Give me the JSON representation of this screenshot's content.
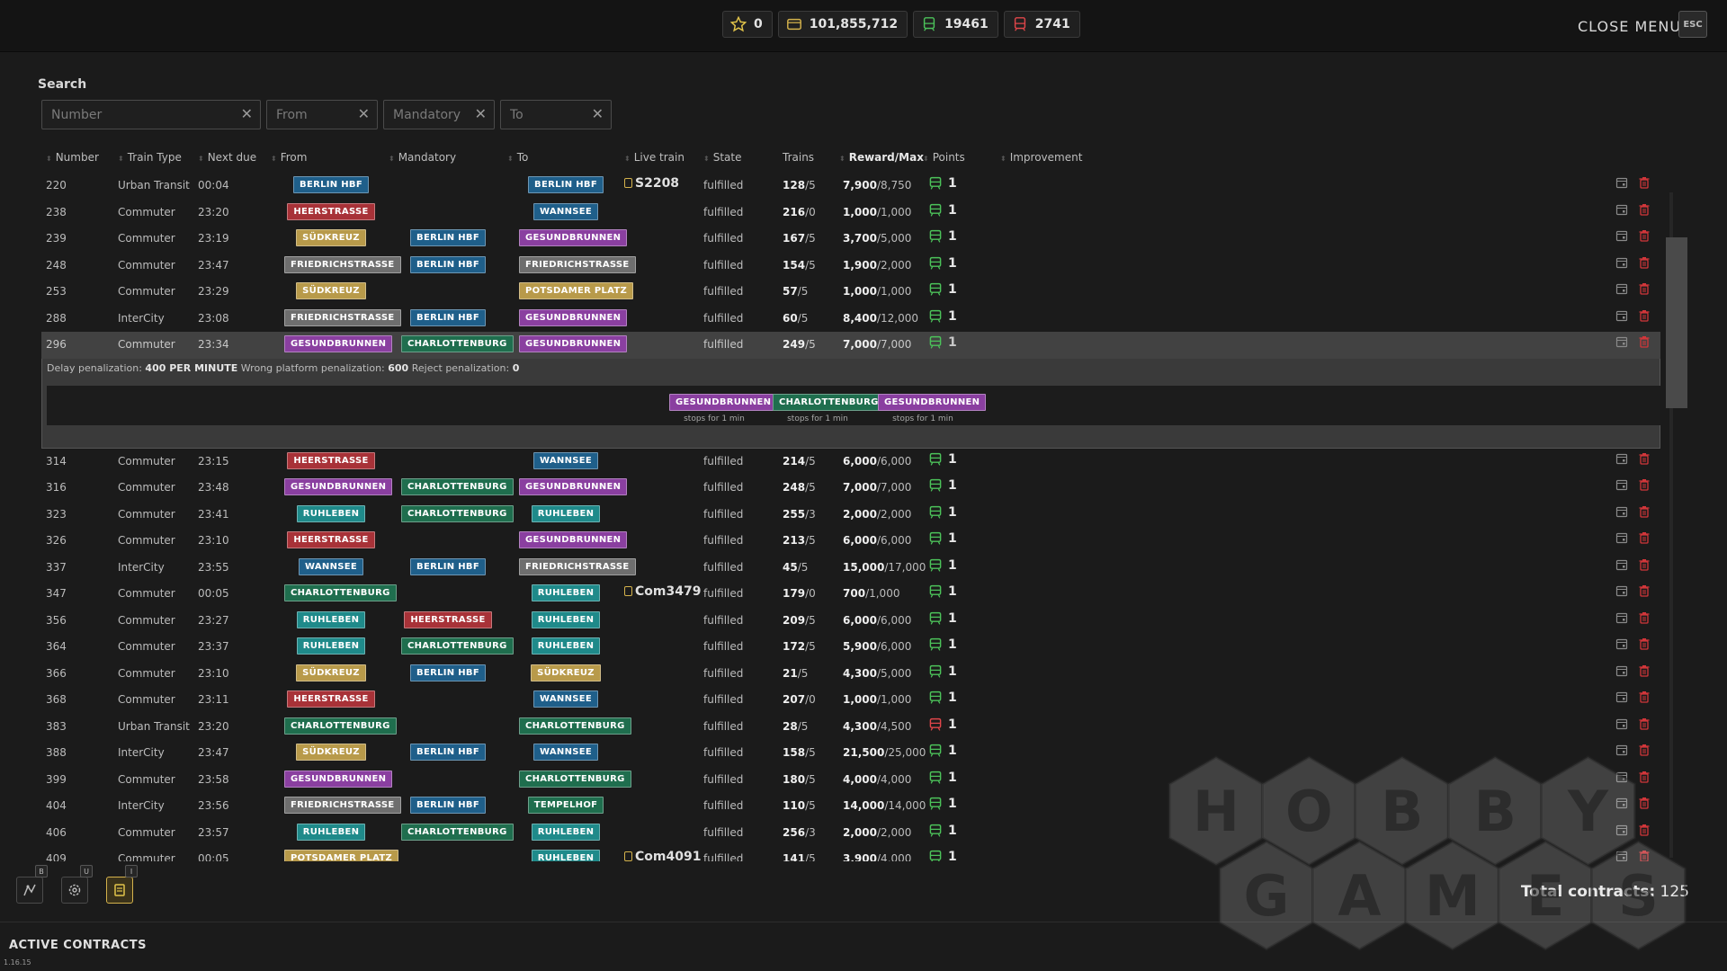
{
  "topbar": {
    "stats": [
      {
        "name": "star-icon",
        "value": "0",
        "color": "#e2c44a"
      },
      {
        "name": "money-icon",
        "value": "101,855,712",
        "color": "#d4b24c"
      },
      {
        "name": "train-green-icon",
        "value": "19461",
        "color": "#4cc25a"
      },
      {
        "name": "train-red-icon",
        "value": "2741",
        "color": "#e0464a"
      }
    ],
    "close_label": "CLOSE MENU",
    "esc_label": "ESC"
  },
  "search": {
    "title": "Search",
    "filters": [
      {
        "placeholder": "Number",
        "value": ""
      },
      {
        "placeholder": "From",
        "value": ""
      },
      {
        "placeholder": "Mandatory",
        "value": ""
      },
      {
        "placeholder": "To",
        "value": ""
      }
    ]
  },
  "columns": [
    "Number",
    "Train Type",
    "Next due",
    "From",
    "Mandatory",
    "To",
    "Live train",
    "State",
    "Trains",
    "Reward/Max",
    "Points",
    "Improvement"
  ],
  "station_colors": {
    "Berlin HBF": "#1f5f8a",
    "Heerstraße": "#a83238",
    "Südkreuz": "#b89a4a",
    "Friedrichstraße": "#6e6e6e",
    "Gesundbrunnen": "#8a3fa0",
    "Charlottenburg": "#1f6e4e",
    "Wannsee": "#1f5f8a",
    "Potsdamer Platz": "#b89a4a",
    "Ruhleben": "#1f8a8a",
    "Tempelhof": "#1f6e4e"
  },
  "rows": [
    {
      "num": "220",
      "type": "Urban Transit",
      "due": "00:04",
      "from": "Berlin HBF",
      "mand": "",
      "to": "Berlin HBF",
      "live": "S2208",
      "state": "fulfilled",
      "trains": "128",
      "trains_max": "/5",
      "reward": "7,900",
      "reward_max": "/8,750",
      "points": "1",
      "points_ok": true
    },
    {
      "num": "238",
      "type": "Commuter",
      "due": "23:20",
      "from": "Heerstraße",
      "mand": "",
      "to": "Wannsee",
      "live": "",
      "state": "fulfilled",
      "trains": "216",
      "trains_max": "/0",
      "reward": "1,000",
      "reward_max": "/1,000",
      "points": "1",
      "points_ok": true
    },
    {
      "num": "239",
      "type": "Commuter",
      "due": "23:19",
      "from": "Südkreuz",
      "mand": "Berlin HBF",
      "to": "Gesundbrunnen",
      "live": "",
      "state": "fulfilled",
      "trains": "167",
      "trains_max": "/5",
      "reward": "3,700",
      "reward_max": "/5,000",
      "points": "1",
      "points_ok": true
    },
    {
      "num": "248",
      "type": "Commuter",
      "due": "23:47",
      "from": "Friedrichstraße",
      "mand": "Berlin HBF",
      "to": "Friedrichstraße",
      "live": "",
      "state": "fulfilled",
      "trains": "154",
      "trains_max": "/5",
      "reward": "1,900",
      "reward_max": "/2,000",
      "points": "1",
      "points_ok": true
    },
    {
      "num": "253",
      "type": "Commuter",
      "due": "23:29",
      "from": "Südkreuz",
      "mand": "",
      "to": "Potsdamer Platz",
      "live": "",
      "state": "fulfilled",
      "trains": "57",
      "trains_max": "/5",
      "reward": "1,000",
      "reward_max": "/1,000",
      "points": "1",
      "points_ok": true
    },
    {
      "num": "288",
      "type": "InterCity",
      "due": "23:08",
      "from": "Friedrichstraße",
      "mand": "Berlin HBF",
      "to": "Gesundbrunnen",
      "live": "",
      "state": "fulfilled",
      "trains": "60",
      "trains_max": "/5",
      "reward": "8,400",
      "reward_max": "/12,000",
      "points": "1",
      "points_ok": true
    },
    {
      "num": "296",
      "type": "Commuter",
      "due": "23:34",
      "from": "Gesundbrunnen",
      "mand": "Charlottenburg",
      "to": "Gesundbrunnen",
      "live": "",
      "state": "fulfilled",
      "trains": "249",
      "trains_max": "/5",
      "reward": "7,000",
      "reward_max": "/7,000",
      "points": "1",
      "points_ok": true,
      "selected": true
    },
    {
      "num": "314",
      "type": "Commuter",
      "due": "23:15",
      "from": "Heerstraße",
      "mand": "",
      "to": "Wannsee",
      "live": "",
      "state": "fulfilled",
      "trains": "214",
      "trains_max": "/5",
      "reward": "6,000",
      "reward_max": "/6,000",
      "points": "1",
      "points_ok": true
    },
    {
      "num": "316",
      "type": "Commuter",
      "due": "23:48",
      "from": "Gesundbrunnen",
      "mand": "Charlottenburg",
      "to": "Gesundbrunnen",
      "live": "",
      "state": "fulfilled",
      "trains": "248",
      "trains_max": "/5",
      "reward": "7,000",
      "reward_max": "/7,000",
      "points": "1",
      "points_ok": true
    },
    {
      "num": "323",
      "type": "Commuter",
      "due": "23:41",
      "from": "Ruhleben",
      "mand": "Charlottenburg",
      "to": "Ruhleben",
      "live": "",
      "state": "fulfilled",
      "trains": "255",
      "trains_max": "/3",
      "reward": "2,000",
      "reward_max": "/2,000",
      "points": "1",
      "points_ok": true
    },
    {
      "num": "326",
      "type": "Commuter",
      "due": "23:10",
      "from": "Heerstraße",
      "mand": "",
      "to": "Gesundbrunnen",
      "live": "",
      "state": "fulfilled",
      "trains": "213",
      "trains_max": "/5",
      "reward": "6,000",
      "reward_max": "/6,000",
      "points": "1",
      "points_ok": true
    },
    {
      "num": "337",
      "type": "InterCity",
      "due": "23:55",
      "from": "Wannsee",
      "mand": "Berlin HBF",
      "to": "Friedrichstraße",
      "live": "",
      "state": "fulfilled",
      "trains": "45",
      "trains_max": "/5",
      "reward": "15,000",
      "reward_max": "/17,000",
      "points": "1",
      "points_ok": true
    },
    {
      "num": "347",
      "type": "Commuter",
      "due": "00:05",
      "from": "Charlottenburg",
      "mand": "",
      "to": "Ruhleben",
      "live": "Com3479",
      "state": "fulfilled",
      "trains": "179",
      "trains_max": "/0",
      "reward": "700",
      "reward_max": "/1,000",
      "points": "1",
      "points_ok": true
    },
    {
      "num": "356",
      "type": "Commuter",
      "due": "23:27",
      "from": "Ruhleben",
      "mand": "Heerstraße",
      "to": "Ruhleben",
      "live": "",
      "state": "fulfilled",
      "trains": "209",
      "trains_max": "/5",
      "reward": "6,000",
      "reward_max": "/6,000",
      "points": "1",
      "points_ok": true
    },
    {
      "num": "364",
      "type": "Commuter",
      "due": "23:37",
      "from": "Ruhleben",
      "mand": "Charlottenburg",
      "to": "Ruhleben",
      "live": "",
      "state": "fulfilled",
      "trains": "172",
      "trains_max": "/5",
      "reward": "5,900",
      "reward_max": "/6,000",
      "points": "1",
      "points_ok": true
    },
    {
      "num": "366",
      "type": "Commuter",
      "due": "23:10",
      "from": "Südkreuz",
      "mand": "Berlin HBF",
      "to": "Südkreuz",
      "live": "",
      "state": "fulfilled",
      "trains": "21",
      "trains_max": "/5",
      "reward": "4,300",
      "reward_max": "/5,000",
      "points": "1",
      "points_ok": true
    },
    {
      "num": "368",
      "type": "Commuter",
      "due": "23:11",
      "from": "Heerstraße",
      "mand": "",
      "to": "Wannsee",
      "live": "",
      "state": "fulfilled",
      "trains": "207",
      "trains_max": "/0",
      "reward": "1,000",
      "reward_max": "/1,000",
      "points": "1",
      "points_ok": true
    },
    {
      "num": "383",
      "type": "Urban Transit",
      "due": "23:20",
      "from": "Charlottenburg",
      "mand": "",
      "to": "Charlottenburg",
      "live": "",
      "state": "fulfilled",
      "trains": "28",
      "trains_max": "/5",
      "reward": "4,300",
      "reward_max": "/4,500",
      "points": "1",
      "points_ok": false
    },
    {
      "num": "388",
      "type": "InterCity",
      "due": "23:47",
      "from": "Südkreuz",
      "mand": "Berlin HBF",
      "to": "Wannsee",
      "live": "",
      "state": "fulfilled",
      "trains": "158",
      "trains_max": "/5",
      "reward": "21,500",
      "reward_max": "/25,000",
      "points": "1",
      "points_ok": true
    },
    {
      "num": "399",
      "type": "Commuter",
      "due": "23:58",
      "from": "Gesundbrunnen",
      "mand": "",
      "to": "Charlottenburg",
      "live": "",
      "state": "fulfilled",
      "trains": "180",
      "trains_max": "/5",
      "reward": "4,000",
      "reward_max": "/4,000",
      "points": "1",
      "points_ok": true
    },
    {
      "num": "404",
      "type": "InterCity",
      "due": "23:56",
      "from": "Friedrichstraße",
      "mand": "Berlin HBF",
      "to": "Tempelhof",
      "live": "",
      "state": "fulfilled",
      "trains": "110",
      "trains_max": "/5",
      "reward": "14,000",
      "reward_max": "/14,000",
      "points": "1",
      "points_ok": true
    },
    {
      "num": "406",
      "type": "Commuter",
      "due": "23:57",
      "from": "Ruhleben",
      "mand": "Charlottenburg",
      "to": "Ruhleben",
      "live": "",
      "state": "fulfilled",
      "trains": "256",
      "trains_max": "/3",
      "reward": "2,000",
      "reward_max": "/2,000",
      "points": "1",
      "points_ok": true
    },
    {
      "num": "409",
      "type": "Commuter",
      "due": "00:05",
      "from": "Potsdamer Platz",
      "mand": "",
      "to": "Ruhleben",
      "live": "Com4091",
      "state": "fulfilled",
      "trains": "141",
      "trains_max": "/5",
      "reward": "3,900",
      "reward_max": "/4,000",
      "points": "1",
      "points_ok": true
    }
  ],
  "detail": {
    "delay_label": "Delay penalization:",
    "delay_value": "400 PER MINUTE",
    "platform_label": "Wrong platform penalization:",
    "platform_value": "600",
    "reject_label": "Reject penalization:",
    "reject_value": "0",
    "stops": [
      {
        "station": "Gesundbrunnen",
        "note": "stops for 1 min"
      },
      {
        "station": "Charlottenburg",
        "note": "stops for 1 min"
      },
      {
        "station": "Gesundbrunnen",
        "note": "stops for 1 min"
      }
    ]
  },
  "bottom": {
    "tools": [
      {
        "name": "map-tool-icon",
        "key": "B"
      },
      {
        "name": "settings-tool-icon",
        "key": "U"
      },
      {
        "name": "contracts-tool-icon",
        "key": "I",
        "active": true
      }
    ],
    "total_label": "Total contracts:",
    "total_value": "125",
    "active_label": "ACTIVE CONTRACTS",
    "version": "1.16.15"
  },
  "watermark": {
    "line1": [
      "H",
      "O",
      "B",
      "B",
      "Y"
    ],
    "line2": [
      "G",
      "A",
      "M",
      "E",
      "S"
    ]
  }
}
